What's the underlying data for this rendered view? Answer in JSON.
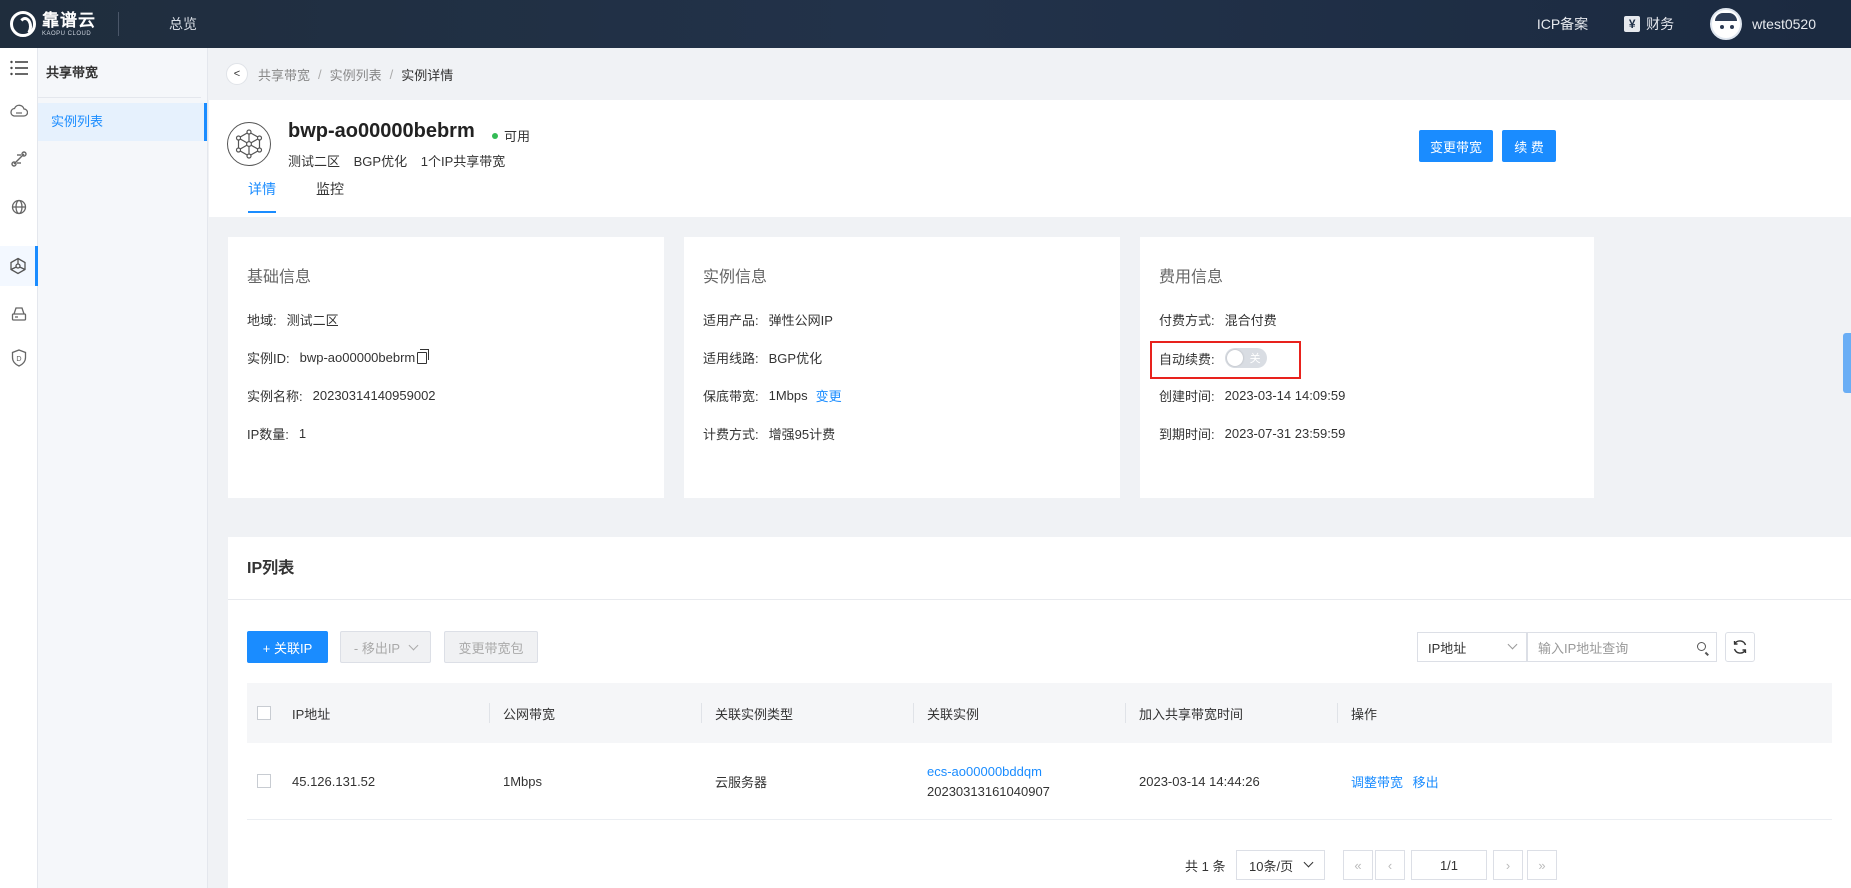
{
  "topbar": {
    "logo_cn": "靠谱云",
    "logo_en": "KAOPU CLOUD",
    "nav_overview": "总览",
    "icp": "ICP备案",
    "finance": "财务",
    "username": "wtest0520"
  },
  "rail": {
    "icons": [
      "menu-icon",
      "cloud-server-icon",
      "network-icon",
      "globe-icon",
      "shared-bandwidth-icon",
      "storage-icon",
      "shield-icon"
    ]
  },
  "subnav": {
    "title": "共享带宽",
    "item": "实例列表"
  },
  "breadcrumb": {
    "back": "<",
    "level1": "共享带宽",
    "level2": "实例列表",
    "current": "实例详情",
    "sep": "/"
  },
  "instance": {
    "name": "bwp-ao00000bebrm",
    "status": "可用",
    "region": "测试二区",
    "line": "BGP优化",
    "desc": "1个IP共享带宽",
    "tabs": [
      "详情",
      "监控"
    ],
    "btn_change": "变更带宽",
    "btn_renew": "续 费"
  },
  "basic": {
    "title": "基础信息",
    "region_label": "地域:",
    "region_value": "测试二区",
    "id_label": "实例ID:",
    "id_value": "bwp-ao00000bebrm",
    "name_label": "实例名称:",
    "name_value": "20230314140959002",
    "ipcount_label": "IP数量:",
    "ipcount_value": "1"
  },
  "instance_info": {
    "title": "实例信息",
    "product_label": "适用产品:",
    "product_value": "弹性公网IP",
    "line_label": "适用线路:",
    "line_value": "BGP优化",
    "bw_label": "保底带宽:",
    "bw_value": "1Mbps",
    "bw_link": "变更",
    "billing_label": "计费方式:",
    "billing_value": "增强95计费"
  },
  "fee": {
    "title": "费用信息",
    "pay_label": "付费方式:",
    "pay_value": "混合付费",
    "auto_label": "自动续费:",
    "auto_switch": "关",
    "created_label": "创建时间:",
    "created_value": "2023-03-14 14:09:59",
    "expire_label": "到期时间:",
    "expire_value": "2023-07-31 23:59:59"
  },
  "ip_list": {
    "title": "IP列表",
    "btn_add": "+ 关联IP",
    "btn_remove": "- 移出IP",
    "btn_change_pkg": "变更带宽包",
    "filter_select": "IP地址",
    "search_placeholder": "输入IP地址查询",
    "columns": [
      "IP地址",
      "公网带宽",
      "关联实例类型",
      "关联实例",
      "加入共享带宽时间",
      "操作"
    ],
    "rows": [
      {
        "ip": "45.126.131.52",
        "bandwidth": "1Mbps",
        "type": "云服务器",
        "instance_id": "ecs-ao00000bddqm",
        "instance_name": "20230313161040907",
        "joined": "2023-03-14 14:44:26",
        "action_adjust": "调整带宽",
        "action_remove": "移出"
      }
    ],
    "total": "共 1 条",
    "page_size": "10条/页",
    "page": "1/1"
  }
}
